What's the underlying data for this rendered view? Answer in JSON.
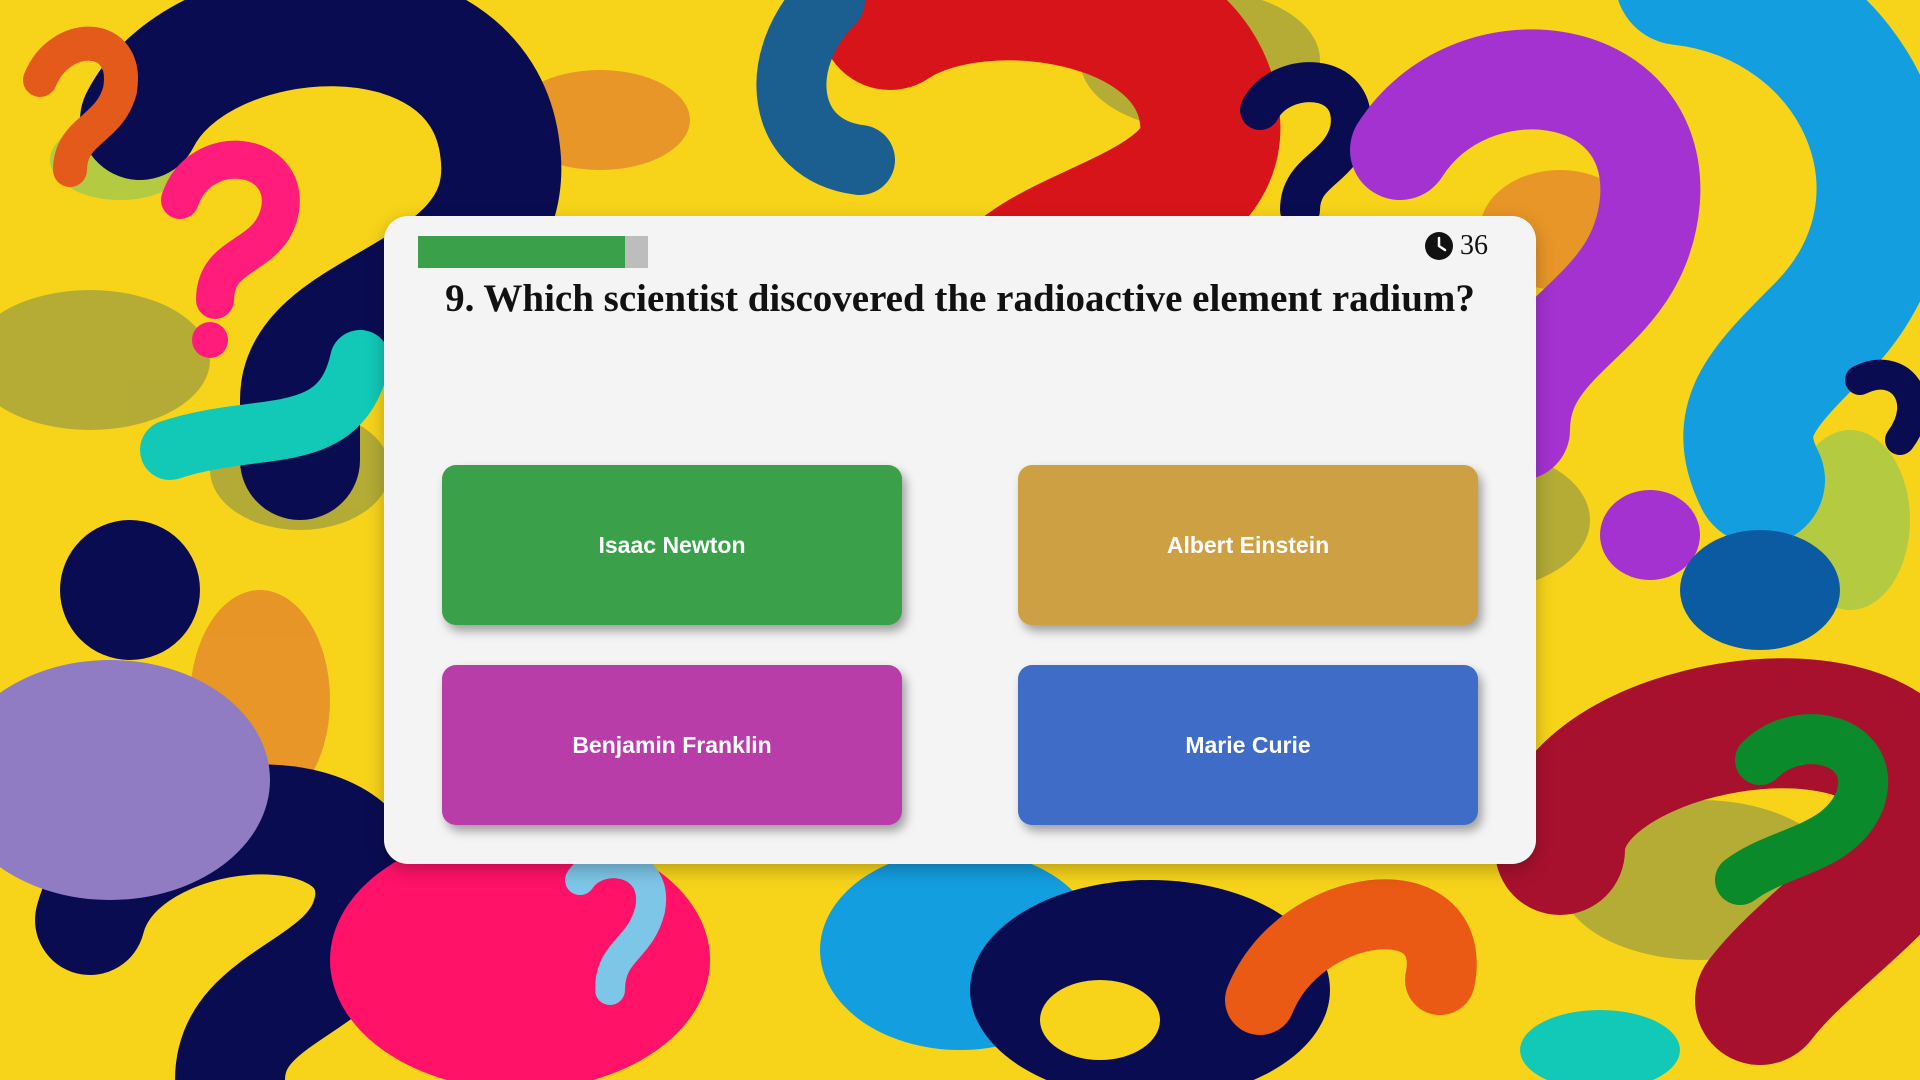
{
  "quiz": {
    "question": "9. Which scientist discovered the radioactive element radium?",
    "timer_seconds": "36",
    "progress_fraction": 0.9,
    "progress_color": "#3ba04a",
    "answers": [
      {
        "label": "Isaac Newton",
        "color": "#3aa14a"
      },
      {
        "label": "Albert Einstein",
        "color": "#cda044"
      },
      {
        "label": "Benjamin Franklin",
        "color": "#b93da8"
      },
      {
        "label": "Marie Curie",
        "color": "#3f6cc6"
      }
    ]
  },
  "background": {
    "pattern": "colorful-question-marks",
    "base_color": "#f7d41a"
  }
}
